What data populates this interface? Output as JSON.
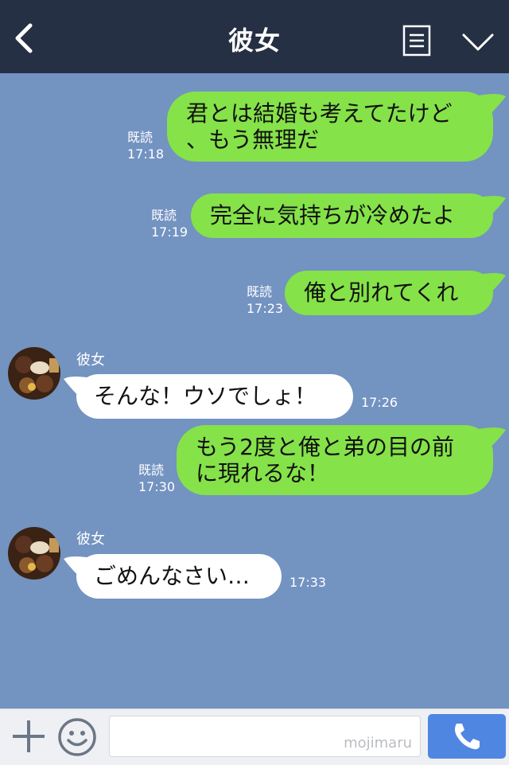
{
  "header": {
    "title": "彼女"
  },
  "messages_out": [
    {
      "text_lines": [
        "君とは結婚も考えてたけど",
        "、もう無理だ"
      ],
      "read": "既読",
      "time": "17:18"
    },
    {
      "text_lines": [
        "完全に気持ちが冷めたよ"
      ],
      "read": "既読",
      "time": "17:19"
    },
    {
      "text_lines": [
        "俺と別れてくれ"
      ],
      "read": "既読",
      "time": "17:23"
    },
    {
      "text_lines": [
        "もう2度と俺と弟の目の前",
        "に現れるな！"
      ],
      "read": "既読",
      "time": "17:30"
    }
  ],
  "messages_in": [
    {
      "sender": "彼女",
      "text": "そんな！ウソでしょ！",
      "time": "17:26"
    },
    {
      "sender": "彼女",
      "text": "ごめんなさい…",
      "time": "17:33"
    }
  ],
  "footer": {
    "watermark": "mojimaru",
    "input_value": ""
  },
  "colors": {
    "header_bg": "#263044",
    "chat_bg": "#7393c1",
    "out_bubble": "#85e249",
    "in_bubble": "#ffffff",
    "call_button": "#4f86e2"
  },
  "icons": [
    "back-icon",
    "menu-icon",
    "chevron-down-icon",
    "plus-icon",
    "smile-icon",
    "phone-icon"
  ]
}
